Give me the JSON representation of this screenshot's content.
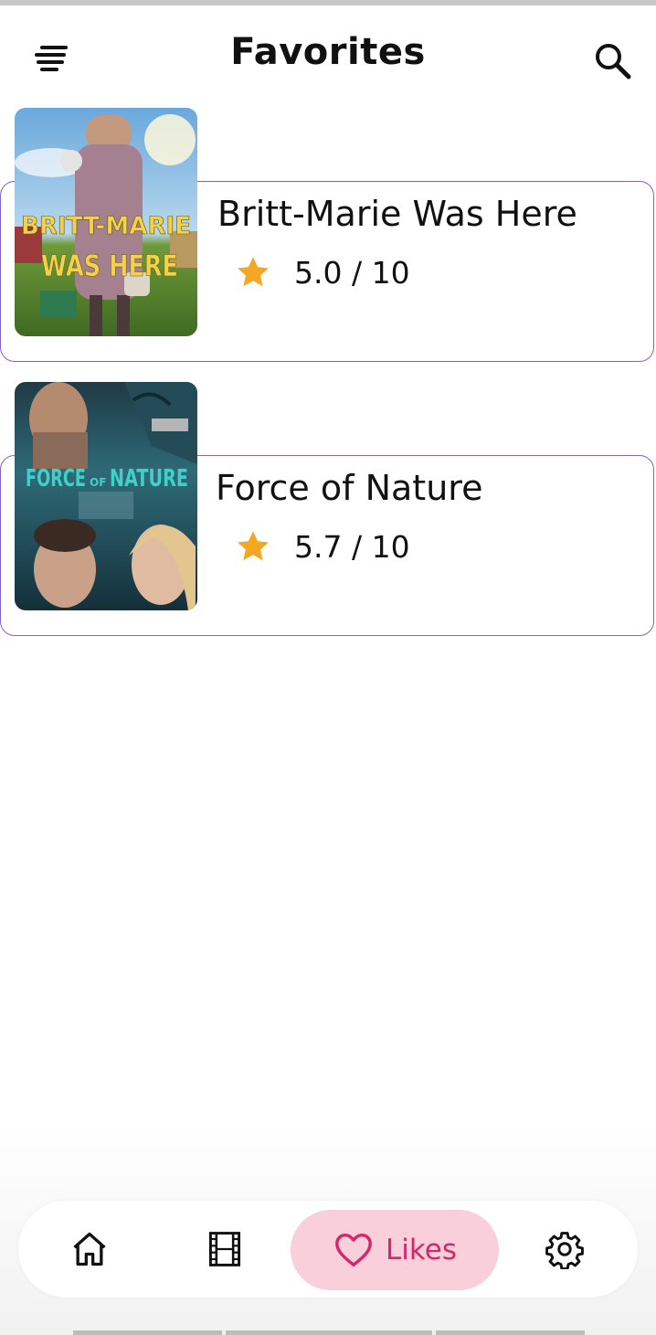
{
  "header": {
    "title": "Favorites",
    "menu_icon": "menu-icon",
    "search_icon": "search-icon"
  },
  "favorites": [
    {
      "title": "Britt-Marie Was Here",
      "rating": "5.0 / 10",
      "poster_text": [
        "BRITT-MARIE",
        "WAS HERE"
      ]
    },
    {
      "title": "Force of Nature",
      "rating": "5.7 / 10",
      "poster_text": [
        "FORCE",
        "OF",
        "NATURE"
      ]
    }
  ],
  "bottom_nav": {
    "items": [
      {
        "icon": "home-icon"
      },
      {
        "icon": "film-icon"
      },
      {
        "icon": "heart-icon",
        "label": "Likes",
        "active": true
      },
      {
        "icon": "gear-icon"
      }
    ]
  },
  "colors": {
    "card_border": "#8064c8",
    "star": "#f5a623",
    "active_bg": "#f9cfdc",
    "active_fg": "#d6266a"
  }
}
